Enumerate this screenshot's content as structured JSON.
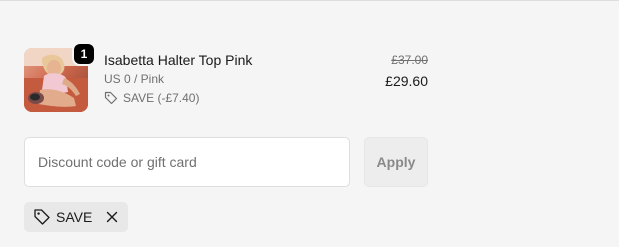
{
  "line_item": {
    "quantity": "1",
    "product_name": "Isabetta Halter Top Pink",
    "variant": "US 0 / Pink",
    "discount_label": "SAVE (-£7.40)",
    "compare_at_price": "£37.00",
    "price": "£29.60",
    "thumbnail_icon": "product-photo"
  },
  "discount_form": {
    "placeholder": "Discount code or gift card",
    "value": "",
    "apply_label": "Apply"
  },
  "applied_code": {
    "label": "SAVE",
    "tag_icon": "tag-icon",
    "remove_icon": "close-icon"
  },
  "colors": {
    "background": "#f5f5f5",
    "text": "#1a1a1a",
    "muted_text": "#707070",
    "badge": "#000000",
    "apply_button_bg": "#ededed",
    "tag_bg": "#e8e8e8"
  }
}
